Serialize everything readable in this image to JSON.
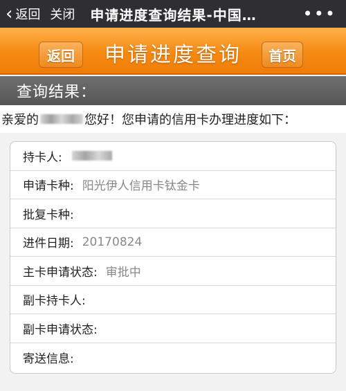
{
  "topbar": {
    "back_label": "返回",
    "close_label": "关闭",
    "title": "申请进度查询结果-中国…",
    "more": "•••"
  },
  "header": {
    "back_label": "返回",
    "title": "申请进度查询",
    "home_label": "首页"
  },
  "section_title": "查询结果：",
  "greeting": {
    "prefix": "亲爱的",
    "suffix": "您好！您申请的信用卡办理进度如下："
  },
  "rows": [
    {
      "label": "持卡人:",
      "value": ""
    },
    {
      "label": "申请卡种:",
      "value": "阳光伊人信用卡钛金卡"
    },
    {
      "label": "批复卡种:",
      "value": ""
    },
    {
      "label": "进件日期:",
      "value": "20170824"
    },
    {
      "label": "主卡申请状态:",
      "value": "审批中"
    },
    {
      "label": "副卡持卡人:",
      "value": ""
    },
    {
      "label": "副卡申请状态:",
      "value": ""
    },
    {
      "label": "寄送信息:",
      "value": ""
    }
  ],
  "colors": {
    "accent": "#f58a13",
    "topbar": "#2e2e33",
    "section_bar": "#606060"
  },
  "icons": {
    "back": "chevron-left-icon",
    "more": "more-dots-icon"
  }
}
